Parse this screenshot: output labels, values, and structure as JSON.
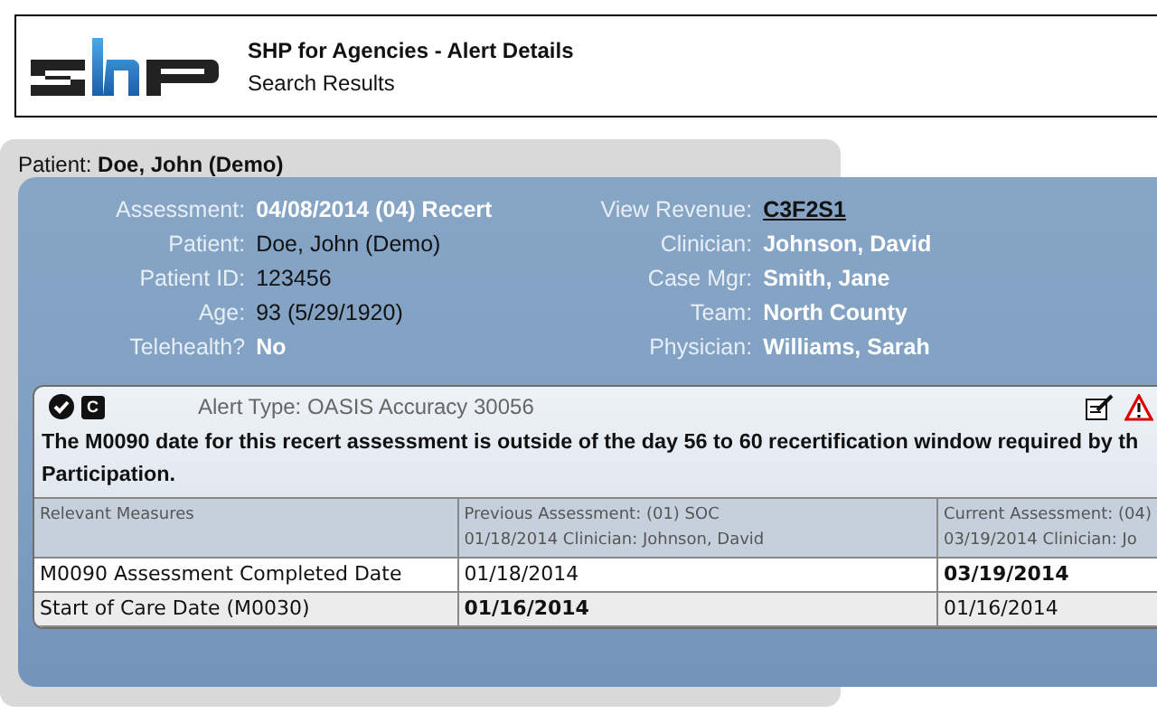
{
  "header": {
    "title": "SHP for Agencies - Alert Details",
    "subtitle": "Search Results"
  },
  "patient_bar": {
    "label": "Patient:",
    "value": "Doe, John (Demo)"
  },
  "details_left": [
    {
      "label": "Assessment:",
      "value": "04/08/2014 (04) Recert",
      "kind": "text",
      "emphasis": true
    },
    {
      "label": "Patient:",
      "value": "Doe, John (Demo)",
      "kind": "text",
      "emphasis": false
    },
    {
      "label": "Patient ID:",
      "value": "123456",
      "kind": "text",
      "emphasis": false
    },
    {
      "label": "Age:",
      "value": "93 (5/29/1920)",
      "kind": "text",
      "emphasis": false
    },
    {
      "label": "Telehealth?",
      "value": "No",
      "kind": "text",
      "emphasis": true
    }
  ],
  "details_right": [
    {
      "label": "View Revenue:",
      "value": "C3F2S1",
      "kind": "link",
      "emphasis": false
    },
    {
      "label": "Clinician:",
      "value": "Johnson, David",
      "kind": "text",
      "emphasis": true
    },
    {
      "label": "Case Mgr:",
      "value": "Smith, Jane",
      "kind": "text",
      "emphasis": true
    },
    {
      "label": "Team:",
      "value": "North County",
      "kind": "text",
      "emphasis": true
    },
    {
      "label": "Physician:",
      "value": "Williams, Sarah",
      "kind": "text",
      "emphasis": true
    }
  ],
  "alert": {
    "badge": "C",
    "type": "Alert Type: OASIS Accuracy 30056",
    "message_lines": [
      "The M0090 date for this recert assessment is outside of the day 56 to 60 recertification window required by th",
      "Participation."
    ],
    "table": {
      "columns": [
        {
          "lines": [
            "Relevant Measures"
          ]
        },
        {
          "lines": [
            "Previous Assessment: (01) SOC",
            "01/18/2014 Clinician: Johnson, David"
          ]
        },
        {
          "lines": [
            "Current Assessment: (04)",
            "03/19/2014 Clinician: Jo"
          ]
        }
      ],
      "rows": [
        {
          "cells": [
            {
              "text": "M0090 Assessment Completed Date",
              "bold": false
            },
            {
              "text": "01/18/2014",
              "bold": false
            },
            {
              "text": "03/19/2014",
              "bold": true
            }
          ]
        },
        {
          "cells": [
            {
              "text": "Start of Care Date (M0030)",
              "bold": false
            },
            {
              "text": "01/16/2014",
              "bold": true
            },
            {
              "text": "01/16/2014",
              "bold": false
            }
          ]
        }
      ]
    }
  }
}
